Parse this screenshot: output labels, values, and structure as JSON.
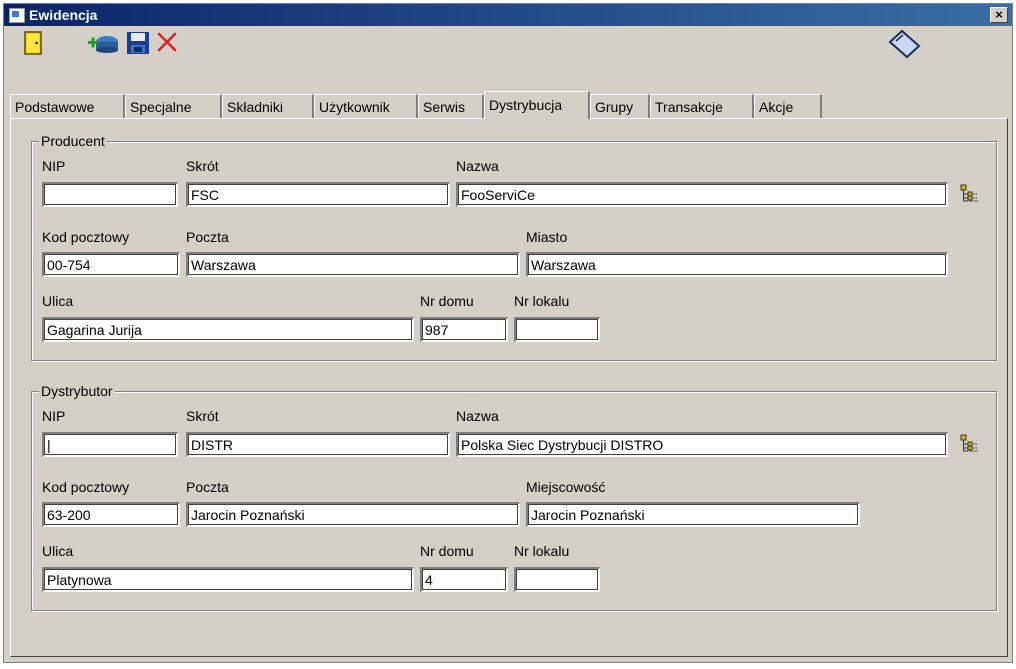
{
  "window": {
    "title": "Ewidencja",
    "close_label": "×"
  },
  "toolbar": {
    "exit_icon": "door-exit-icon",
    "add_icon": "add-record-icon",
    "save_icon": "floppy-save-icon",
    "delete_icon": "red-x-delete-icon",
    "attach_icon": "folder-clip-icon"
  },
  "tabs": [
    "Podstawowe",
    "Specjalne",
    "Składniki",
    "Użytkownik",
    "Serwis",
    "Dystrybucja",
    "Grupy",
    "Transakcje",
    "Akcje"
  ],
  "active_tab": "Dystrybucja",
  "producent": {
    "title": "Producent",
    "nip_label": "NIP",
    "nip": "",
    "skrot_label": "Skrót",
    "skrot": "FSC",
    "nazwa_label": "Nazwa",
    "nazwa": "FooServiCe",
    "kod_label": "Kod pocztowy",
    "kod": "00-754",
    "poczta_label": "Poczta",
    "poczta": "Warszawa",
    "miasto_label": "Miasto",
    "miasto": "Warszawa",
    "ulica_label": "Ulica",
    "ulica": "Gagarina Jurija",
    "nrdomu_label": "Nr domu",
    "nrdomu": "987",
    "nrlokalu_label": "Nr lokalu",
    "nrlokalu": ""
  },
  "dystrybutor": {
    "title": "Dystrybutor",
    "nip_label": "NIP",
    "nip": "|",
    "skrot_label": "Skrót",
    "skrot": "DISTR",
    "nazwa_label": "Nazwa",
    "nazwa": "Polska Siec Dystrybucji DISTRO",
    "kod_label": "Kod pocztowy",
    "kod": "63-200",
    "poczta_label": "Poczta",
    "poczta": "Jarocin Poznański",
    "miasto_label": "Miejscowość",
    "miasto": "Jarocin Poznański",
    "ulica_label": "Ulica",
    "ulica": "Platynowa",
    "nrdomu_label": "Nr domu",
    "nrdomu": "4",
    "nrlokalu_label": "Nr lokalu",
    "nrlokalu": ""
  },
  "icons": {
    "lookup": "tree-lookup-icon"
  },
  "colors": {
    "face": "#d4d0c8",
    "title_start": "#0a246a",
    "title_end": "#3a6ea5",
    "delete": "#e02020"
  }
}
